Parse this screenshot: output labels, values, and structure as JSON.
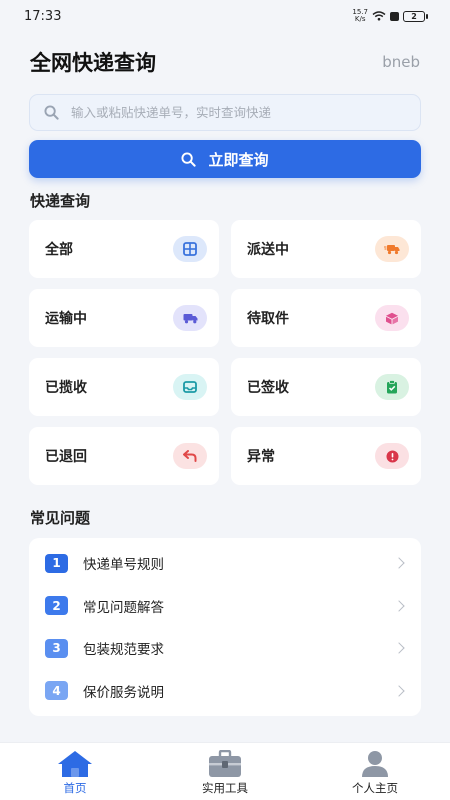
{
  "status_bar": {
    "time": "17:33",
    "net_speed_top": "15.7",
    "net_speed_bottom": "K/s",
    "battery": "2"
  },
  "header": {
    "title": "全网快递查询",
    "user_name": "bneb"
  },
  "search": {
    "placeholder": "输入或粘贴快递单号，实时查询快递",
    "value": ""
  },
  "query_button": {
    "label": "立即查询"
  },
  "status_section": {
    "title": "快递查询",
    "items": [
      {
        "label": "全部",
        "icon": "grid-icon",
        "bg": "#dde8fb",
        "color": "#3a73dd"
      },
      {
        "label": "派送中",
        "icon": "delivery-truck-icon",
        "bg": "#fde7d6",
        "color": "#f07a2c"
      },
      {
        "label": "运输中",
        "icon": "truck-icon",
        "bg": "#e3e3fb",
        "color": "#5b5bd6"
      },
      {
        "label": "待取件",
        "icon": "package-icon",
        "bg": "#fbe0ee",
        "color": "#e0508f"
      },
      {
        "label": "已揽收",
        "icon": "inbox-icon",
        "bg": "#d9f4f4",
        "color": "#1c9aa6"
      },
      {
        "label": "已签收",
        "icon": "clipboard-check-icon",
        "bg": "#d9f2e2",
        "color": "#25a55a"
      },
      {
        "label": "已退回",
        "icon": "return-arrow-icon",
        "bg": "#fbe2e2",
        "color": "#e04848"
      },
      {
        "label": "异常",
        "icon": "alert-icon",
        "bg": "#fbe0e3",
        "color": "#d9364a"
      }
    ]
  },
  "faq_section": {
    "title": "常见问题",
    "items": [
      {
        "num": "1",
        "text": "快递单号规则",
        "color": "#2d6be4"
      },
      {
        "num": "2",
        "text": "常见问题解答",
        "color": "#3d7aec"
      },
      {
        "num": "3",
        "text": "包装规范要求",
        "color": "#5a8ff0"
      },
      {
        "num": "4",
        "text": "保价服务说明",
        "color": "#7aa6f3"
      }
    ]
  },
  "bottom_nav": {
    "items": [
      {
        "label": "首页",
        "icon": "home-icon",
        "active": true
      },
      {
        "label": "实用工具",
        "icon": "toolbox-icon",
        "active": false
      },
      {
        "label": "个人主页",
        "icon": "user-icon",
        "active": false
      }
    ]
  },
  "colors": {
    "primary": "#2d6be4",
    "background": "#f3f5f9"
  }
}
